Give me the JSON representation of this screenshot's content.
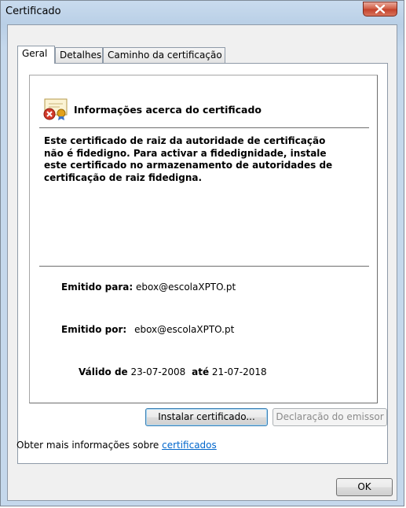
{
  "window": {
    "title": "Certificado"
  },
  "tabs": [
    {
      "label": "Geral",
      "active": true
    },
    {
      "label": "Detalhes",
      "active": false
    },
    {
      "label": "Caminho da certificação",
      "active": false
    }
  ],
  "info": {
    "icon": "certificate-error-icon",
    "title": "Informações acerca do certificado",
    "body": "Este certificado de raiz da autoridade de certificação não é fidedigno. Para activar a fidedignidade, instale este certificado no armazenamento de autoridades de certificação de raiz fidedigna."
  },
  "fields": {
    "issued_to_label": "Emitido para:",
    "issued_to_value": "ebox@escolaXPTO.pt",
    "issued_by_label": "Emitido por:",
    "issued_by_value": "ebox@escolaXPTO.pt",
    "valid_from_label": "Válido de",
    "valid_from_value": "23-07-2008",
    "valid_to_label": "até",
    "valid_to_value": "21-07-2018"
  },
  "buttons": {
    "install": "Instalar certificado...",
    "issuer_statement": "Declaração do emissor",
    "ok": "OK"
  },
  "more_info": {
    "text": "Obter mais informações sobre",
    "link": "certificados"
  },
  "colors": {
    "accent": "#3c7fb1",
    "close": "#c3402a"
  }
}
